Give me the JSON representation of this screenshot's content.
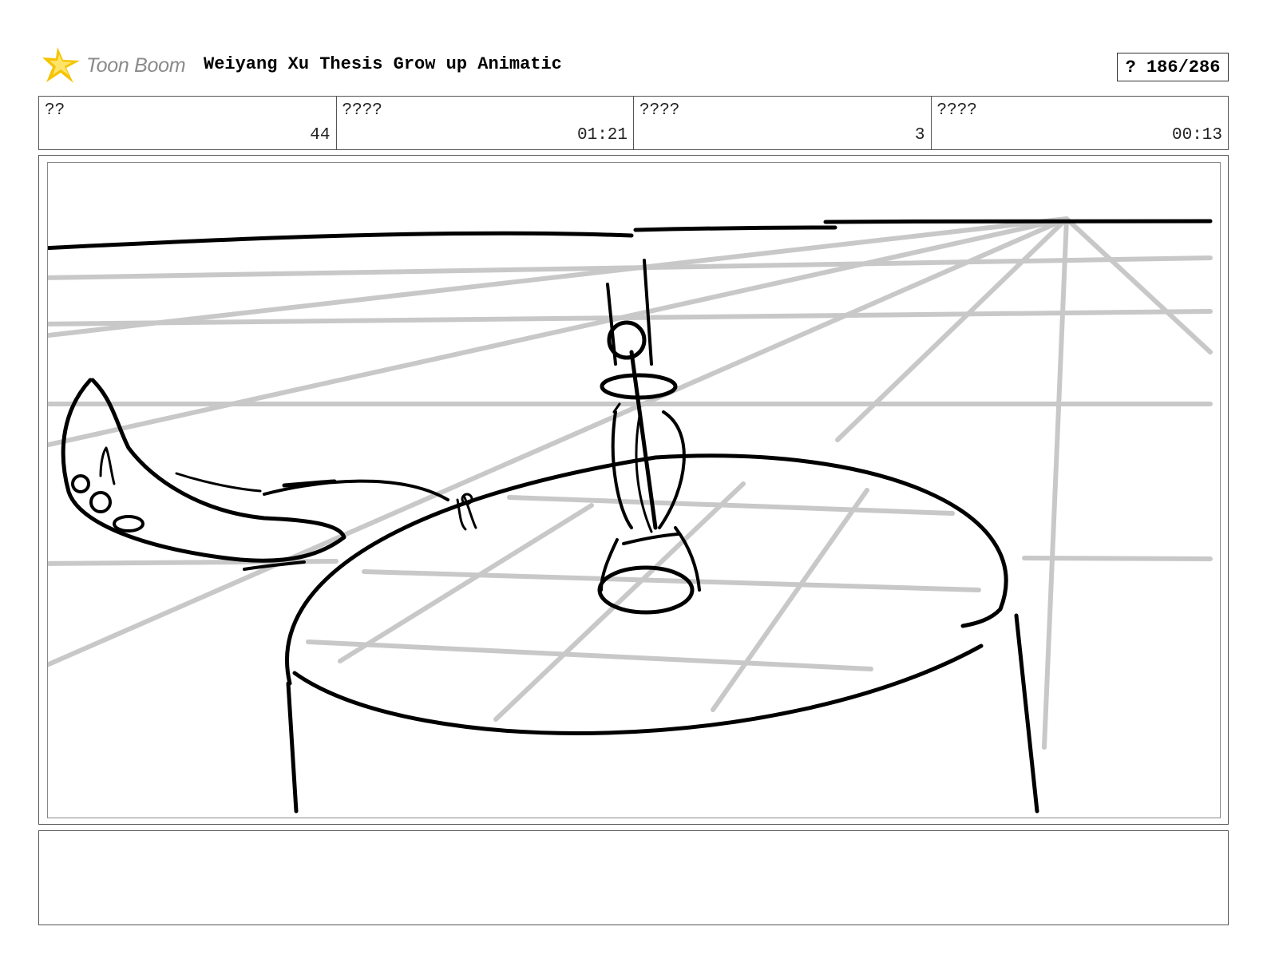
{
  "header": {
    "logo_text": "Toon Boom",
    "title": "Weiyang Xu Thesis Grow up Animatic",
    "page_indicator": "? 186/286"
  },
  "info": [
    {
      "label": "??",
      "value": "44"
    },
    {
      "label": "????",
      "value": "01:21"
    },
    {
      "label": "????",
      "value": "3"
    },
    {
      "label": "????",
      "value": "00:13"
    }
  ],
  "notes": {
    "text": ""
  },
  "colors": {
    "logo_star": "#f5c400",
    "logo_text": "#8a8a8a",
    "sketch_ink": "#000000",
    "guide_lines": "#c8c8c8"
  },
  "icons": {
    "logo": "toon-boom-star-icon"
  }
}
